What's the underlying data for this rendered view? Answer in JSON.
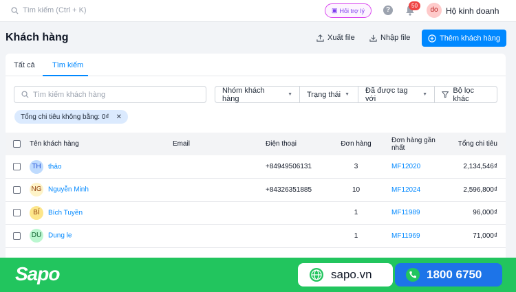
{
  "topbar": {
    "search_placeholder": "Tìm kiếm (Ctrl + K)",
    "support_label": "Hỏi trợ lý",
    "notification_count": "50",
    "avatar_initials": "do",
    "store_name": "Hộ kinh doanh"
  },
  "page": {
    "title": "Khách hàng",
    "export_label": "Xuất file",
    "import_label": "Nhập file",
    "add_label": "Thêm khách hàng"
  },
  "tabs": [
    "Tất cả",
    "Tìm kiếm"
  ],
  "filters": {
    "search_placeholder": "Tìm kiếm khách hàng",
    "group": "Nhóm khách hàng",
    "status": "Trạng thái",
    "tagged": "Đã được tag với",
    "other": "Bộ lọc khác"
  },
  "active_filter": "Tổng chi tiêu không bằng: 0₫",
  "table": {
    "headers": [
      "Tên khách hàng",
      "Email",
      "Điện thoại",
      "Đơn hàng",
      "Đơn hàng gần nhất",
      "Tổng chi tiêu"
    ],
    "rows": [
      {
        "initials": "TH",
        "avatar_bg": "#bfdbfe",
        "avatar_fg": "#1d4ed8",
        "name": "thảo",
        "email": "",
        "phone": "+84949506131",
        "orders": "3",
        "last_order": "MF12020",
        "total": "2,134,546₫"
      },
      {
        "initials": "NG",
        "avatar_bg": "#fef3c7",
        "avatar_fg": "#92400e",
        "name": "Nguyễn Minh",
        "email": "",
        "phone": "+84326351885",
        "orders": "10",
        "last_order": "MF12024",
        "total": "2,596,800₫"
      },
      {
        "initials": "BÍ",
        "avatar_bg": "#fde68a",
        "avatar_fg": "#92400e",
        "name": "Bích Tuyền",
        "email": "",
        "phone": "",
        "orders": "1",
        "last_order": "MF11989",
        "total": "96,000₫"
      },
      {
        "initials": "DU",
        "avatar_bg": "#bbf7d0",
        "avatar_fg": "#166534",
        "name": "Dung le",
        "email": "",
        "phone": "",
        "orders": "1",
        "last_order": "MF11969",
        "total": "71,000₫"
      }
    ]
  },
  "banner": {
    "logo": "Sapo",
    "website": "sapo.vn",
    "hotline": "1800 6750"
  },
  "colors": {
    "primary": "#0088ff",
    "banner_green": "#22c55e",
    "phone_blue": "#1d74e8"
  }
}
